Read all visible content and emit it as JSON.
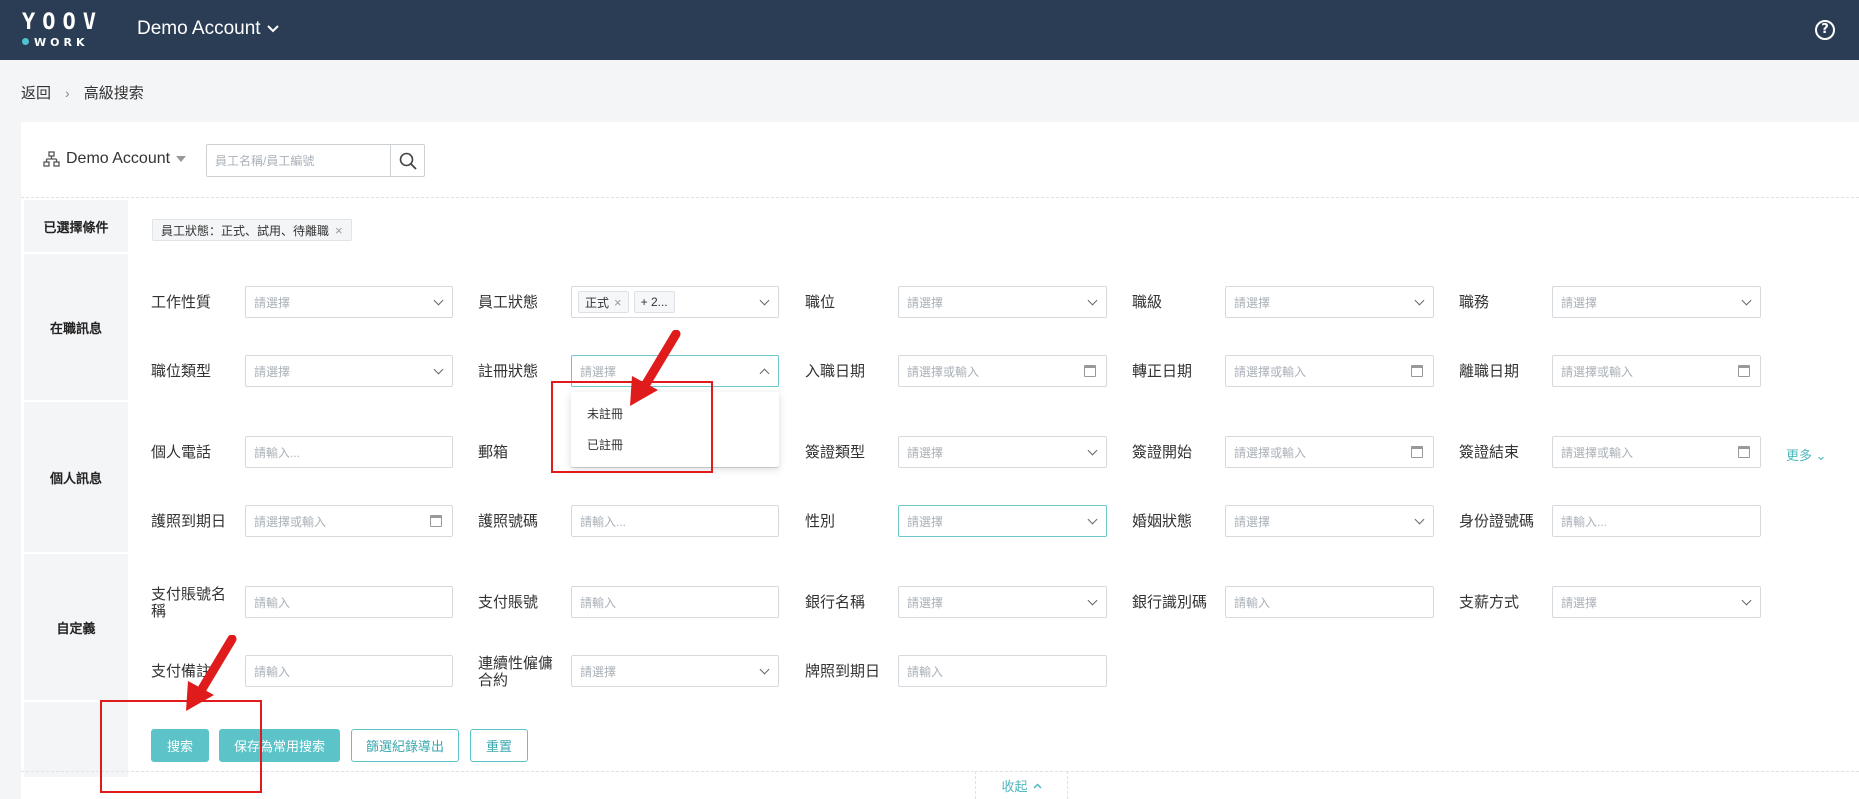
{
  "header": {
    "logo_top": "YOOV",
    "logo_bottom": "WORK",
    "account": "Demo Account",
    "help_glyph": "?"
  },
  "breadcrumb": {
    "back": "返回",
    "current": "高級搜索"
  },
  "search": {
    "org": "Demo Account",
    "placeholder": "員工名稱/員工編號"
  },
  "sections": {
    "selected": "已選擇條件",
    "job": "在職訊息",
    "personal": "個人訊息",
    "custom": "自定義"
  },
  "selected_tag": "員工狀態：正式、試用、待離職",
  "fields": {
    "work_nature": {
      "label": "工作性質",
      "placeholder": "請選擇"
    },
    "emp_status": {
      "label": "員工狀態",
      "chip1": "正式",
      "chip2": "+ 2..."
    },
    "position": {
      "label": "職位",
      "placeholder": "請選擇"
    },
    "grade": {
      "label": "職級",
      "placeholder": "請選擇"
    },
    "duty": {
      "label": "職務",
      "placeholder": "請選擇"
    },
    "position_type": {
      "label": "職位類型",
      "placeholder": "請選擇"
    },
    "reg_status": {
      "label": "註冊狀態",
      "placeholder": "請選擇"
    },
    "join_date": {
      "label": "入職日期",
      "placeholder": "請選擇或輸入"
    },
    "confirm_date": {
      "label": "轉正日期",
      "placeholder": "請選擇或輸入"
    },
    "leave_date": {
      "label": "離職日期",
      "placeholder": "請選擇或輸入"
    },
    "phone": {
      "label": "個人電話",
      "placeholder": "請輸入..."
    },
    "email": {
      "label": "郵箱"
    },
    "visa_type": {
      "label": "簽證類型",
      "placeholder": "請選擇"
    },
    "visa_start": {
      "label": "簽證開始",
      "placeholder": "請選擇或輸入"
    },
    "visa_end": {
      "label": "簽證結束",
      "placeholder": "請選擇或輸入"
    },
    "passport_expiry": {
      "label": "護照到期日",
      "placeholder": "請選擇或輸入"
    },
    "passport_no": {
      "label": "護照號碼",
      "placeholder": "請輸入..."
    },
    "gender": {
      "label": "性別",
      "placeholder": "請選擇"
    },
    "marital": {
      "label": "婚姻狀態",
      "placeholder": "請選擇"
    },
    "id_no": {
      "label": "身份證號碼",
      "placeholder": "請輸入..."
    },
    "pay_account_name": {
      "label": "支付賬號名稱",
      "placeholder": "請輸入"
    },
    "pay_account": {
      "label": "支付賬號",
      "placeholder": "請輸入"
    },
    "bank_name": {
      "label": "銀行名稱",
      "placeholder": "請選擇"
    },
    "bank_code": {
      "label": "銀行識別碼",
      "placeholder": "請輸入"
    },
    "pay_method": {
      "label": "支薪方式",
      "placeholder": "請選擇"
    },
    "pay_note": {
      "label": "支付備註",
      "placeholder": "請輸入"
    },
    "contract": {
      "label": "連續性僱傭合約",
      "placeholder": "請選擇"
    },
    "license_expiry": {
      "label": "牌照到期日",
      "placeholder": "請輸入"
    }
  },
  "dropdown_options": [
    "未註冊",
    "已註冊"
  ],
  "more": "更多",
  "buttons": {
    "search": "搜索",
    "save": "保存為常用搜索",
    "export": "篩選紀錄導出",
    "reset": "重置"
  },
  "collapse": "收起",
  "colors": {
    "topbar": "#2b3d54",
    "accent": "#5cc4c9",
    "annotation": "#e01b1b"
  }
}
